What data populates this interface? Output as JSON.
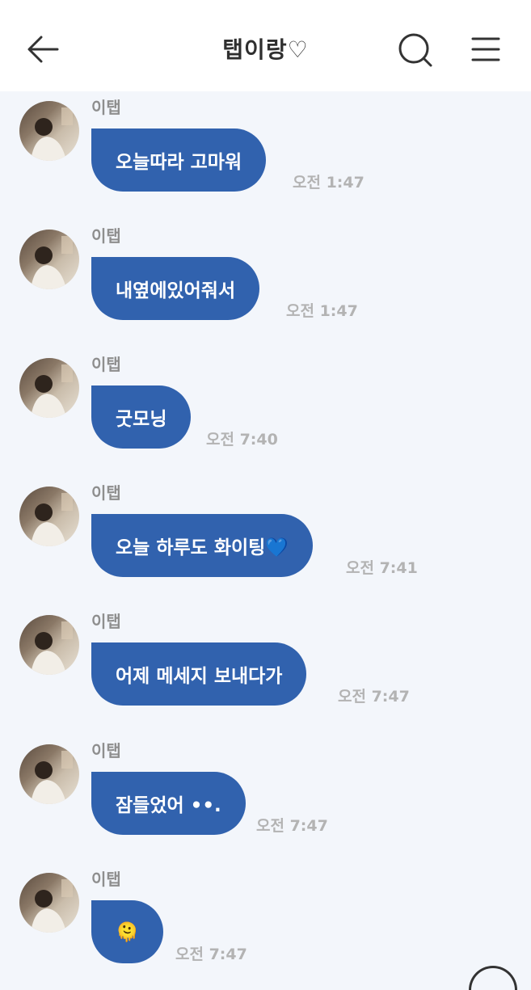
{
  "header": {
    "title": "탭이랑♡",
    "back_icon": "arrow-left-icon",
    "search_icon": "search-icon",
    "menu_icon": "hamburger-menu-icon"
  },
  "colors": {
    "bubble": "#3162ae",
    "background": "#f3f6fb",
    "header_bg": "#ffffff",
    "time_text": "#b3b3b3",
    "sender_text": "#8e8e8e"
  },
  "messages": [
    {
      "sender": "이탭",
      "text": "오늘따라 고마워",
      "time": "오전 1:47"
    },
    {
      "sender": "이탭",
      "text": "내옆에있어줘서",
      "time": "오전 1:47"
    },
    {
      "sender": "이탭",
      "text": "굿모닝",
      "time": "오전 7:40"
    },
    {
      "sender": "이탭",
      "text": "오늘 하루도 화이팅💙",
      "time": "오전 7:41"
    },
    {
      "sender": "이탭",
      "text": "어제 메세지 보내다가",
      "time": "오전 7:47"
    },
    {
      "sender": "이탭",
      "text": "잠들었어 ••.",
      "time": "오전 7:47"
    },
    {
      "sender": "이탭",
      "text": "🫠",
      "time": "오전 7:47"
    }
  ]
}
